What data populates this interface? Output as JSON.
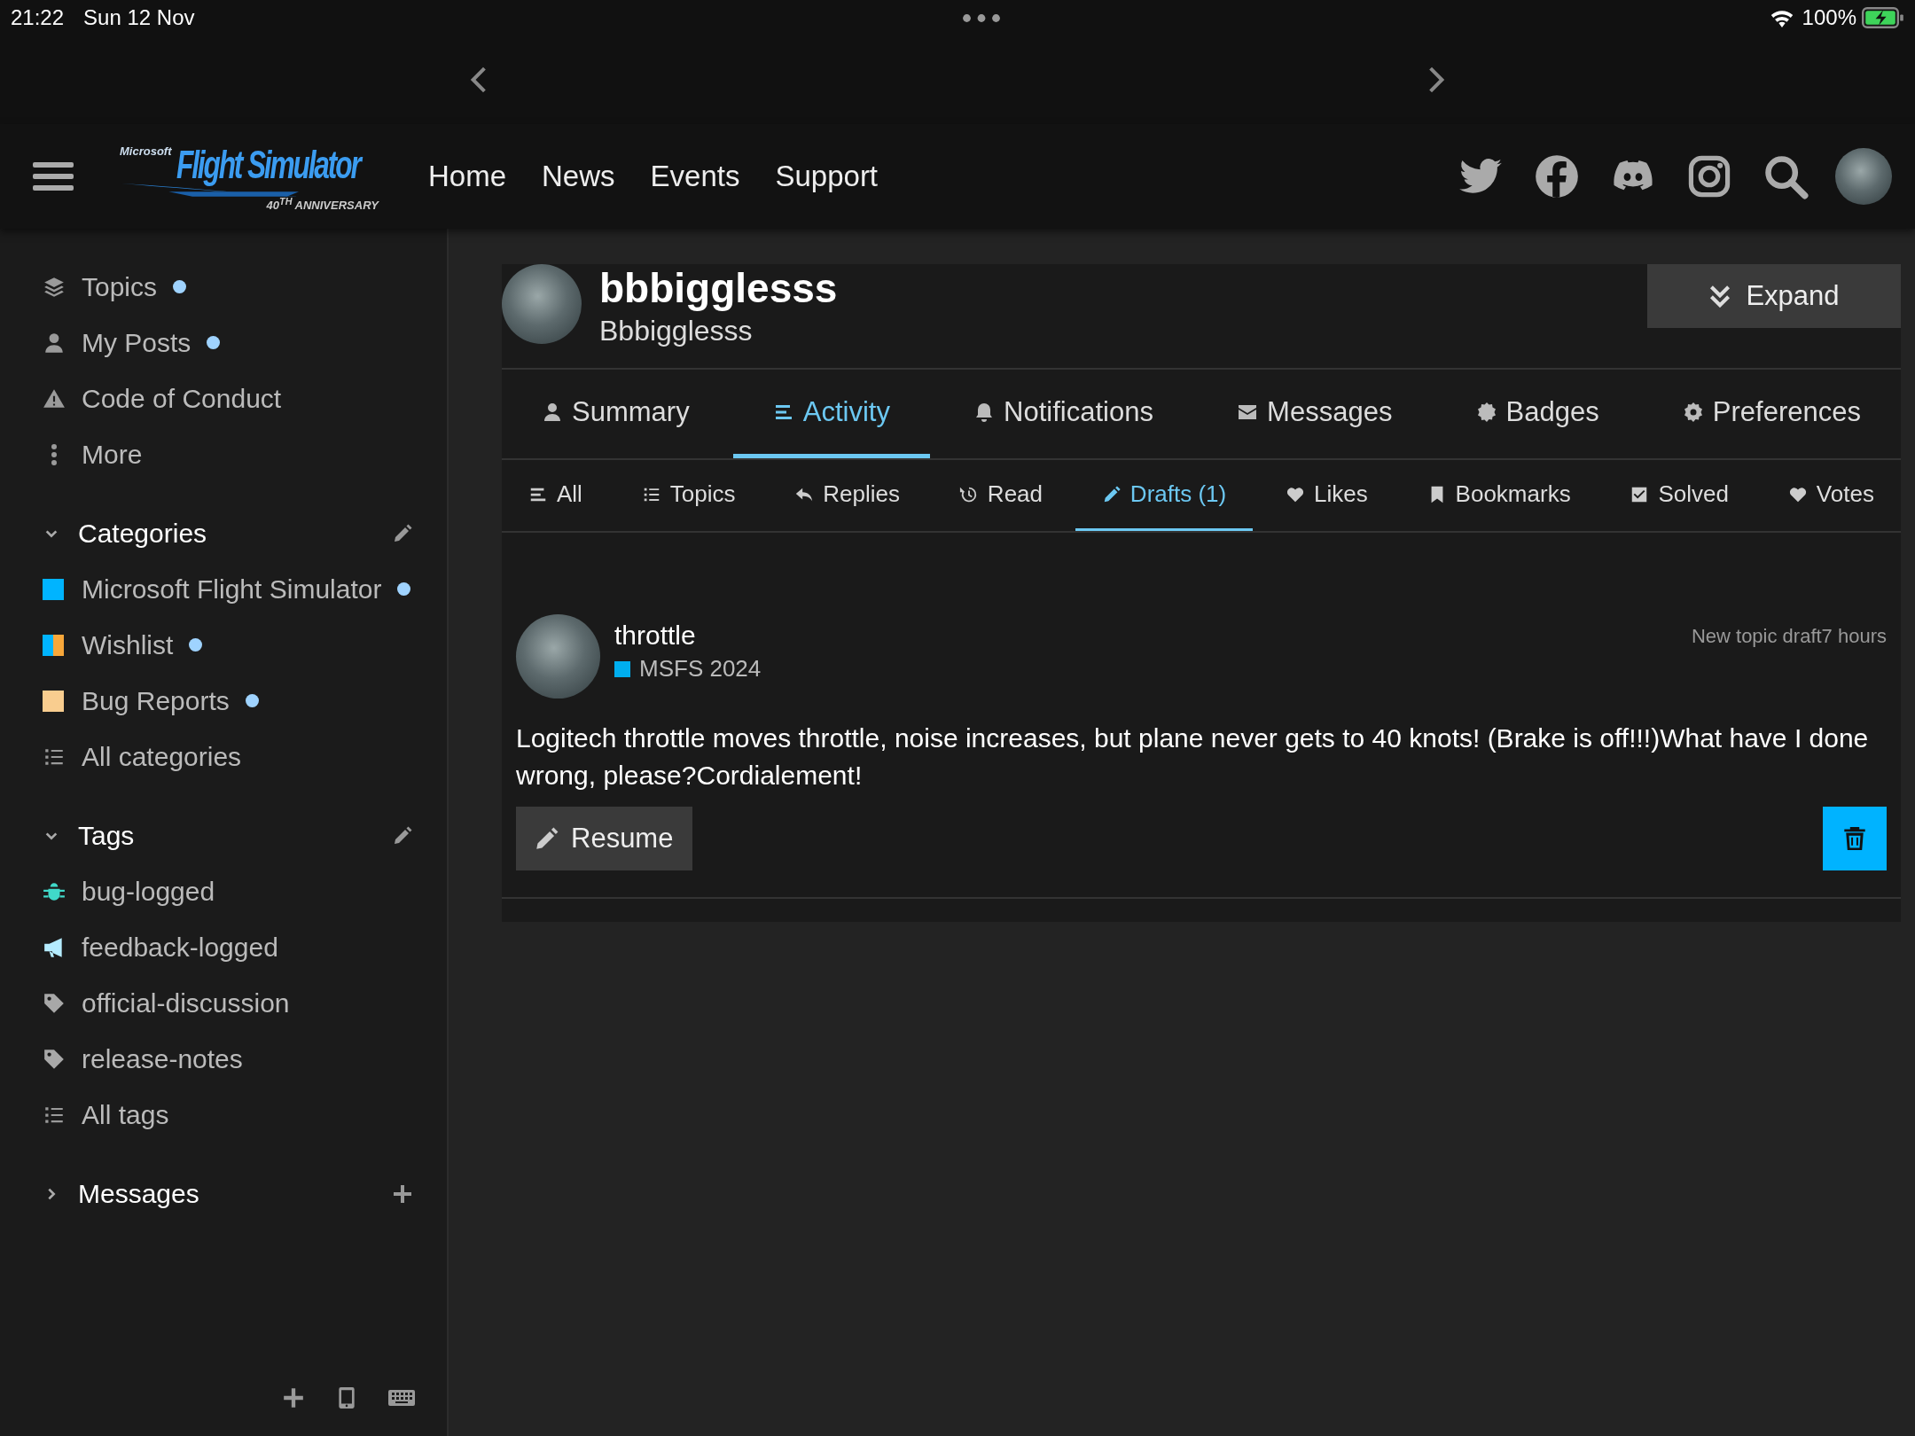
{
  "status_bar": {
    "time": "21:22",
    "date": "Sun 12 Nov",
    "battery": "100%"
  },
  "logo": {
    "brand": "Microsoft",
    "title": "Flight Simulator",
    "subtitle": "40$^{TH}$ ANNIVERSARY"
  },
  "nav_links": [
    "Home",
    "News",
    "Events",
    "Support"
  ],
  "sidebar": {
    "items": [
      {
        "label": "Topics",
        "kind": "layers",
        "unread": true
      },
      {
        "label": "My Posts",
        "kind": "user",
        "unread": true
      },
      {
        "label": "Code of Conduct",
        "kind": "warning",
        "unread": false
      },
      {
        "label": "More",
        "kind": "more",
        "unread": false
      }
    ],
    "sections": [
      {
        "title": "Categories",
        "expanded": true,
        "kind": "edit",
        "items": [
          {
            "label": "Microsoft Flight Simulator",
            "kind": "swatch",
            "swatches": [
              {
                "color": "#00b4ff"
              }
            ],
            "unread": true
          },
          {
            "label": "Wishlist",
            "kind": "swatch",
            "swatches": [
              {
                "color": "#00b4ff"
              },
              {
                "color": "#f7a73a"
              }
            ],
            "unread": true
          },
          {
            "label": "Bug Reports",
            "kind": "swatch",
            "swatches": [
              {
                "color": "#f9cd8f"
              }
            ],
            "unread": true
          },
          {
            "label": "All categories",
            "kind": "list",
            "unread": false
          }
        ]
      },
      {
        "title": "Tags",
        "expanded": true,
        "kind": "edit",
        "items": [
          {
            "label": "bug-logged",
            "kind": "bug",
            "color": "#40d9c9",
            "unread": false
          },
          {
            "label": "feedback-logged",
            "kind": "bullhorn",
            "color": "#b5ecff",
            "unread": false
          },
          {
            "label": "official-discussion",
            "kind": "tag",
            "color": "#a8a8a8",
            "unread": false
          },
          {
            "label": "release-notes",
            "kind": "tag",
            "color": "#a8a8a8",
            "unread": false
          },
          {
            "label": "All tags",
            "kind": "list",
            "unread": false
          }
        ]
      },
      {
        "title": "Messages",
        "expanded": false,
        "kind": "add"
      }
    ]
  },
  "profile": {
    "username": "bbbigglesss",
    "name": "Bbbigglesss",
    "expand": "Expand"
  },
  "tabs": [
    {
      "label": "Summary",
      "kind": "user",
      "selected": false
    },
    {
      "label": "Activity",
      "kind": "bars",
      "selected": true
    },
    {
      "label": "Notifications",
      "kind": "bell",
      "selected": false
    },
    {
      "label": "Messages",
      "kind": "envelope",
      "selected": false
    },
    {
      "label": "Badges",
      "kind": "badge",
      "selected": false
    },
    {
      "label": "Preferences",
      "kind": "gear",
      "selected": false
    }
  ],
  "subtabs": [
    {
      "label": "All",
      "kind": "bars",
      "selected": false
    },
    {
      "label": "Topics",
      "kind": "list",
      "selected": false
    },
    {
      "label": "Replies",
      "kind": "reply",
      "selected": false
    },
    {
      "label": "Read",
      "kind": "history",
      "selected": false
    },
    {
      "label": "Drafts (1)",
      "kind": "pencil",
      "selected": true
    },
    {
      "label": "Likes",
      "kind": "heart",
      "selected": false
    },
    {
      "label": "Bookmarks",
      "kind": "bookmark",
      "selected": false
    },
    {
      "label": "Solved",
      "kind": "check",
      "selected": false
    },
    {
      "label": "Votes",
      "kind": "heart",
      "selected": false
    }
  ],
  "draft": {
    "title": "throttle",
    "category": {
      "name": "MSFS 2024",
      "color": "#00aeef"
    },
    "meta": "New topic draft7 hours",
    "body": "Logitech throttle moves throttle, noise increases, but plane never gets to 40 knots! (Brake is off!!!)What have I done wrong, please?Cordialement!",
    "resume": "Resume"
  }
}
